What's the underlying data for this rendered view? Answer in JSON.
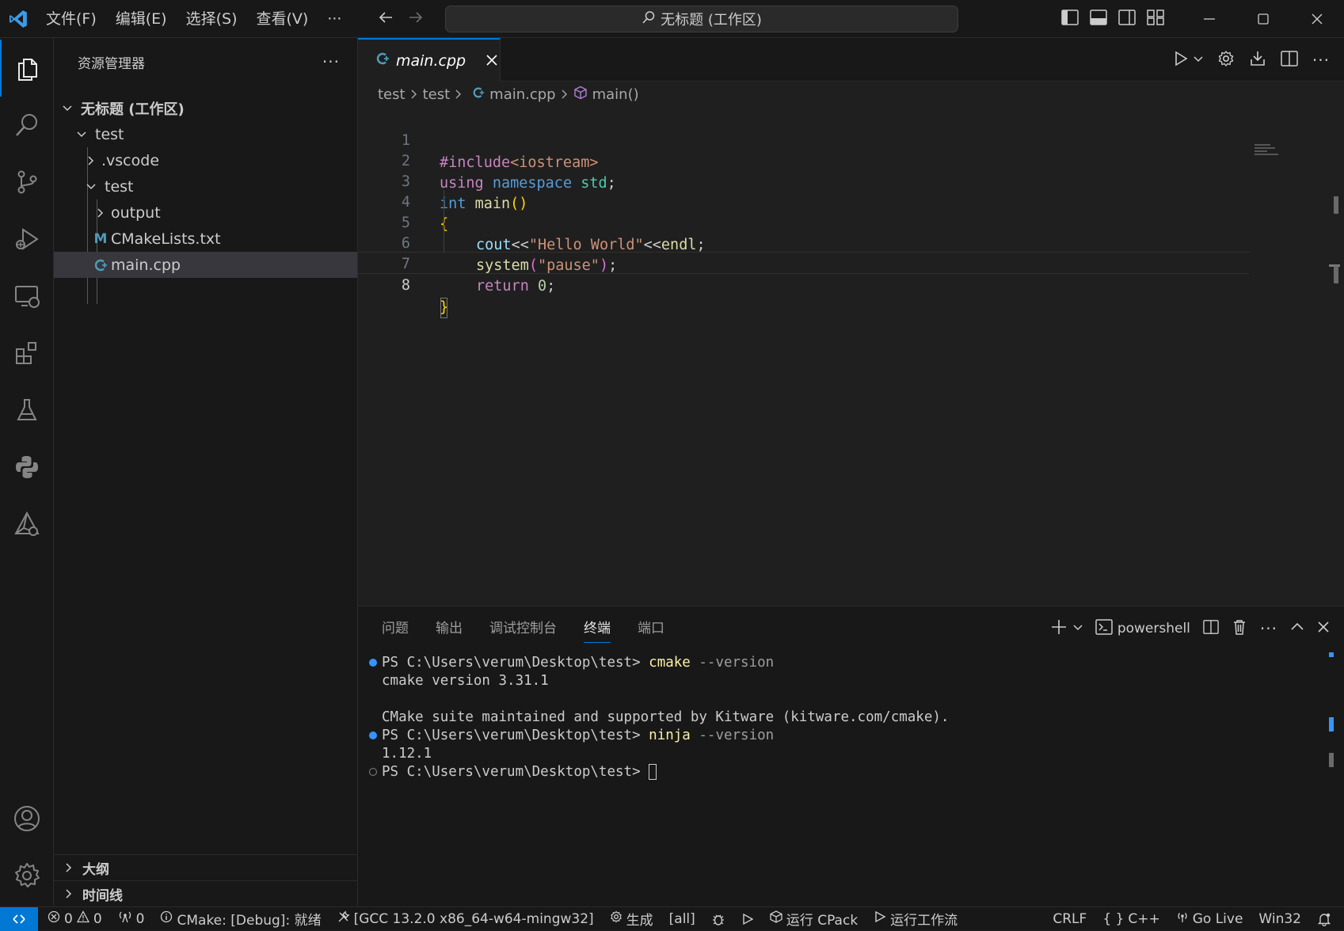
{
  "titlebar": {
    "menu": [
      "文件(F)",
      "编辑(E)",
      "选择(S)",
      "查看(V)",
      "···"
    ],
    "search_text": "无标题 (工作区)"
  },
  "sidebar": {
    "title": "资源管理器",
    "more": "···",
    "workspace": "无标题 (工作区)",
    "tree": [
      {
        "label": "test"
      },
      {
        "label": ".vscode"
      },
      {
        "label": "test"
      },
      {
        "label": "output"
      },
      {
        "label": "CMakeLists.txt",
        "icon": "M"
      },
      {
        "label": "main.cpp"
      }
    ],
    "outline": "大纲",
    "timeline": "时间线"
  },
  "editor": {
    "tab_label": "main.cpp",
    "breadcrumb": [
      "test",
      "test",
      "main.cpp",
      "main()"
    ],
    "line_numbers": [
      "1",
      "2",
      "3",
      "4",
      "5",
      "6",
      "7",
      "8"
    ],
    "code": {
      "l1": {
        "kw": "#include",
        "inc": "<iostream>"
      },
      "l2": {
        "using": "using",
        "ns": "namespace",
        "std": "std",
        "semi": ";"
      },
      "l3": {
        "int": "int",
        "fn": "main",
        "paren": "()"
      },
      "l4": {
        "brace": "{"
      },
      "l5": {
        "cout": "cout",
        "op1": "<<",
        "str": "\"Hello World\"",
        "op2": "<<",
        "endl": "endl",
        "semi": ";"
      },
      "l6": {
        "fn": "system",
        "open": "(",
        "str": "\"pause\"",
        "close": ")",
        "semi": ";"
      },
      "l7": {
        "ret": "return",
        "num": "0",
        "semi": ";"
      },
      "l8": {
        "brace": "}"
      }
    }
  },
  "panel": {
    "tabs": [
      "问题",
      "输出",
      "调试控制台",
      "终端",
      "端口"
    ],
    "active_tab": "终端",
    "shell": "powershell",
    "more": "···",
    "terminal": {
      "l1_prompt": "PS C:\\Users\\verum\\Desktop\\test> ",
      "l1_cmd": "cmake",
      "l1_arg": " --version",
      "l2": "cmake version 3.31.1",
      "l4": "CMake suite maintained and supported by Kitware (kitware.com/cmake).",
      "l5_prompt": "PS C:\\Users\\verum\\Desktop\\test> ",
      "l5_cmd": "ninja",
      "l5_arg": " --version",
      "l6": "1.12.1",
      "l7_prompt": "PS C:\\Users\\verum\\Desktop\\test> "
    }
  },
  "statusbar": {
    "errors": "0",
    "warnings": "0",
    "ports": "0",
    "cmake": "CMake: [Debug]: 就绪",
    "kit": "[GCC 13.2.0 x86_64-w64-mingw32]",
    "build": "生成",
    "target": "[all]",
    "cpack": "运行 CPack",
    "workflow": "运行工作流",
    "eol": "CRLF",
    "lang": "C++",
    "lang_icon": "{ }",
    "golive": "Go Live",
    "platform": "Win32"
  },
  "colors": {
    "accent": "#0078d4",
    "keyword_purple": "#c586c0",
    "keyword_blue": "#569cd6",
    "type_teal": "#4ec9b0",
    "string": "#ce9178",
    "function": "#dcdcaa",
    "variable": "#9cdcfe",
    "number": "#b5cea8",
    "terminal_cmd": "#f9f1a5",
    "terminal_arg": "#9d9d9d"
  }
}
